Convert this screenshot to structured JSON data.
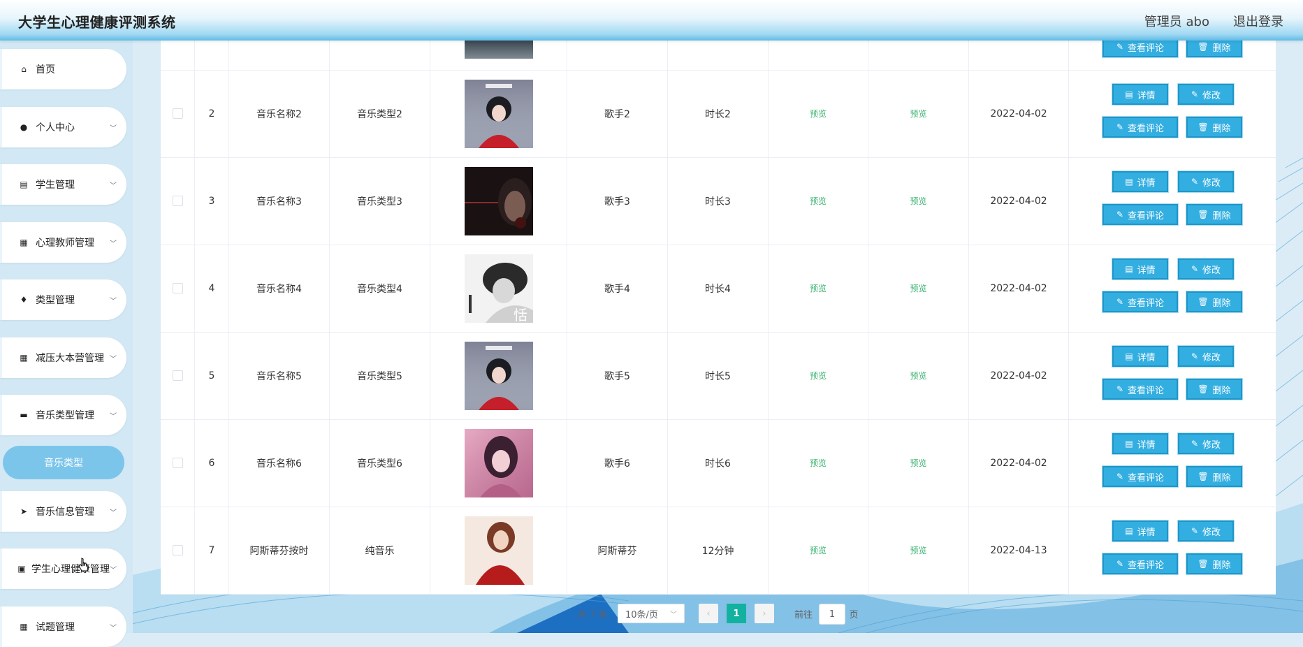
{
  "app": {
    "title": "大学生心理健康评测系统"
  },
  "header": {
    "user_label": "管理员 abo",
    "logout_label": "退出登录"
  },
  "sidebar": {
    "items": [
      {
        "label": "首页",
        "icon": "home-icon",
        "glyph": "⌂",
        "arrow": ""
      },
      {
        "label": "个人中心",
        "icon": "user-icon",
        "glyph": "●",
        "arrow": "﹀"
      },
      {
        "label": "学生管理",
        "icon": "clipboard-icon",
        "glyph": "▤",
        "arrow": "﹀"
      },
      {
        "label": "心理教师管理",
        "icon": "grid-icon",
        "glyph": "▦",
        "arrow": "﹀"
      },
      {
        "label": "类型管理",
        "icon": "bulb-icon",
        "glyph": "♦",
        "arrow": "﹀"
      },
      {
        "label": "减压大本营管理",
        "icon": "apps-icon",
        "glyph": "▦",
        "arrow": "﹀"
      },
      {
        "label": "音乐类型管理",
        "icon": "briefcase-icon",
        "glyph": "▬",
        "arrow": "﹀"
      },
      {
        "label": "音乐信息管理",
        "icon": "send-icon",
        "glyph": "➤",
        "arrow": "﹀"
      },
      {
        "label": "学生心理健康管理",
        "icon": "checklist-icon",
        "glyph": "▣",
        "arrow": "﹀"
      },
      {
        "label": "试题管理",
        "icon": "grid-icon",
        "glyph": "▦",
        "arrow": "﹀"
      }
    ],
    "submenu": {
      "label": "音乐类型"
    }
  },
  "table": {
    "rows": [
      {
        "index": "2",
        "name": "音乐名称2",
        "type": "音乐类型2",
        "singer": "歌手2",
        "duration": "时长2",
        "preview1": "预览",
        "preview2": "预览",
        "date": "2022-04-02",
        "cover": "cover-girl-red"
      },
      {
        "index": "3",
        "name": "音乐名称3",
        "type": "音乐类型3",
        "singer": "歌手3",
        "duration": "时长3",
        "preview1": "预览",
        "preview2": "预览",
        "date": "2022-04-02",
        "cover": "cover-man-dark"
      },
      {
        "index": "4",
        "name": "音乐名称4",
        "type": "音乐类型4",
        "singer": "歌手4",
        "duration": "时长4",
        "preview1": "预览",
        "preview2": "预览",
        "date": "2022-04-02",
        "cover": "cover-bw-portrait"
      },
      {
        "index": "5",
        "name": "音乐名称5",
        "type": "音乐类型5",
        "singer": "歌手5",
        "duration": "时长5",
        "preview1": "预览",
        "preview2": "预览",
        "date": "2022-04-02",
        "cover": "cover-girl-red"
      },
      {
        "index": "6",
        "name": "音乐名称6",
        "type": "音乐类型6",
        "singer": "歌手6",
        "duration": "时长6",
        "preview1": "预览",
        "preview2": "预览",
        "date": "2022-04-02",
        "cover": "cover-pink-woman"
      },
      {
        "index": "7",
        "name": "阿斯蒂芬按时",
        "type": "纯音乐",
        "singer": "阿斯蒂芬",
        "duration": "12分钟",
        "preview1": "预览",
        "preview2": "预览",
        "date": "2022-04-13",
        "cover": "cover-red-coat"
      }
    ],
    "buttons": {
      "detail": "详情",
      "edit": "修改",
      "comments": "查看评论",
      "delete": "删除"
    }
  },
  "pagination": {
    "total": "共 7 条",
    "page_size": "10条/页",
    "current_page": "1",
    "goto_label": "前往",
    "goto_value": "1",
    "page_suffix": "页"
  },
  "colors": {
    "accent": "#33aee1",
    "preview_green": "#3cb371",
    "active_page": "#13b2a0",
    "submenu": "#7cc5ea"
  }
}
